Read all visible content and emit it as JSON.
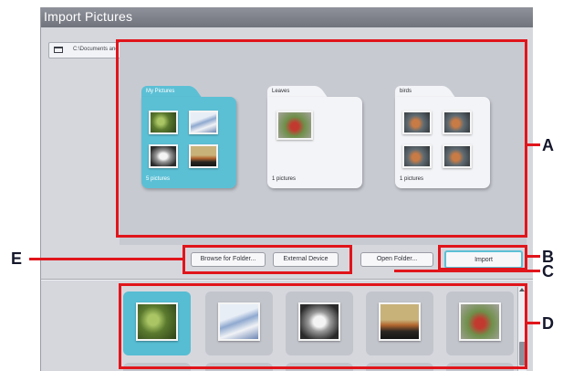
{
  "window": {
    "title": "Import Pictures"
  },
  "path": {
    "text": "C:\\Documents and Settings\\nakshi\\My Documents\\My Pictures"
  },
  "folders": [
    {
      "name": "My Pictures",
      "count": "5 pictures",
      "selected": true
    },
    {
      "name": "Leaves",
      "count": "1 pictures",
      "selected": false
    },
    {
      "name": "birds",
      "count": "1 pictures",
      "selected": false
    }
  ],
  "buttons": {
    "browse": "Browse for Folder...",
    "external": "External Device",
    "open": "Open Folder...",
    "import": "Import"
  },
  "filmstrip": {
    "selected_index": 0,
    "count_visible": 5
  },
  "callouts": {
    "a": "A",
    "b": "B",
    "c": "C",
    "d": "D",
    "e": "E"
  },
  "colors": {
    "accent": "#5cc0d5",
    "annotation_red": "#e0151b",
    "window_bg": "#d6d7dd"
  }
}
